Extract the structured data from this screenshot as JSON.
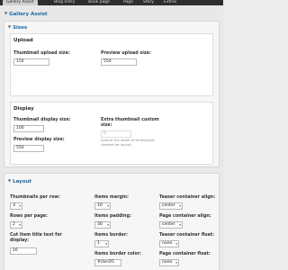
{
  "tabs": [
    {
      "label": "Gallery Assist",
      "active": true
    },
    {
      "label": "Blog entry"
    },
    {
      "label": "Book page"
    },
    {
      "label": "Page"
    },
    {
      "label": "Story"
    },
    {
      "label": "Extras"
    }
  ],
  "group_title": "Gallery Assist",
  "sizes": {
    "legend": "Sizes",
    "upload": {
      "legend": "Upload",
      "thumb_label": "Thumbnail upload size:",
      "thumb_value": "150",
      "preview_label": "Preview upload size:",
      "preview_value": "550"
    },
    "display": {
      "legend": "Display",
      "thumb_label": "Thumbnail display size:",
      "thumb_value": "100",
      "preview_label": "Preview display size:",
      "preview_value": "550",
      "extra_label": "Extra thumbnail custom size:",
      "extra_value": "0",
      "extra_desc": "Extend the width of thumbnails needed for layout."
    }
  },
  "layout": {
    "legend": "Layout",
    "thumbs_per_row_label": "Thumbnails per row:",
    "thumbs_per_row_value": "3",
    "rows_per_page_label": "Rows per page:",
    "rows_per_page_value": "2",
    "cut_title_label": "Cut item title text for display:",
    "cut_title_value": "16",
    "items_margin_label": "Items margin:",
    "items_margin_value": "10",
    "items_padding_label": "Items padding:",
    "items_padding_value": "30",
    "items_border_label": "Items border:",
    "items_border_value": "1",
    "items_border_color_label": "Items border color:",
    "items_border_color_value": "#cbe3f1",
    "teaser_align_label": "Teaser container align:",
    "teaser_align_value": "center",
    "page_align_label": "Page container align:",
    "page_align_value": "center",
    "teaser_float_label": "Teaser container float:",
    "teaser_float_value": "none",
    "page_float_label": "Page container float:",
    "page_float_value": "none"
  }
}
